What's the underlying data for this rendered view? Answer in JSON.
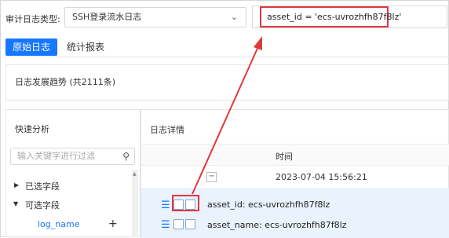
{
  "filter_bar": {
    "type_label": "审计日志类型:",
    "type_value": "SSH登录流水日志",
    "query_value": "asset_id = 'ecs-uvrozhfh87f8lz'"
  },
  "tabs": [
    {
      "label": "原始日志"
    },
    {
      "label": "统计报表"
    }
  ],
  "trend": {
    "title": "日志发展趋势 (共2111条)"
  },
  "quick_analysis": {
    "title": "快速分析",
    "search_placeholder": "输入关键字进行过滤",
    "sections": [
      {
        "label": "已选字段"
      },
      {
        "label": "可选字段"
      }
    ],
    "field": "log_name"
  },
  "details": {
    "title": "日志详情",
    "col_time": "时间",
    "time_value": "2023-07-04 15:56:21",
    "rows": [
      {
        "text": "asset_id: ecs-uvrozhfh87f8lz"
      },
      {
        "text": "asset_name: ecs-uvrozhfh87f8lz"
      }
    ]
  },
  "colors": {
    "accent": "#1677ff",
    "annotation": "#e0383e"
  }
}
